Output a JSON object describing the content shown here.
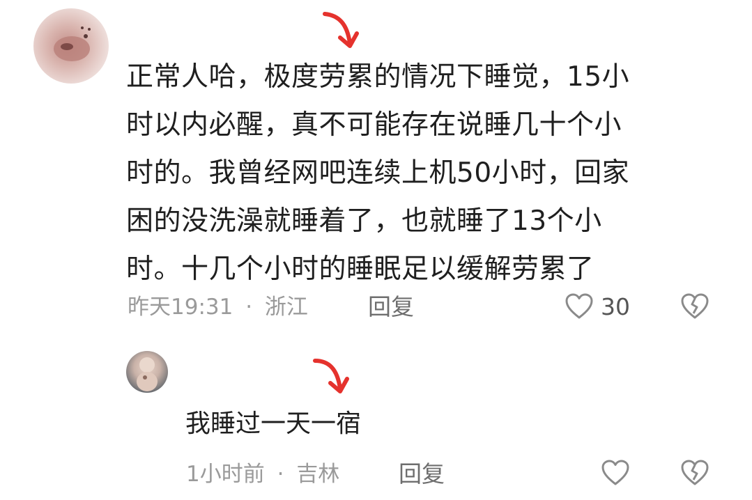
{
  "comment": {
    "text": "正常人哈，极度劳累的情况下睡觉，15小\n时以内必醒，真不可能存在说睡几十个小\n时的。我曾经网吧连续上机50小时，回家\n困的没洗澡就睡着了，也就睡了13个小\n时。十几个小时的睡眠足以缓解劳累了",
    "time": "昨天19:31",
    "location": "浙江",
    "separator": "·",
    "reply_label": "回复",
    "like_count": "30"
  },
  "reply": {
    "text": "我睡过一天一宿",
    "time": "1小时前",
    "location": "吉林",
    "separator": "·",
    "reply_label": "回复"
  },
  "colors": {
    "annotation_arrow": "#e5322d",
    "meta_text": "#9a9a9a",
    "body_text": "#1f1f1f",
    "icon_gray": "#8a8a8a"
  },
  "icons": [
    "heart-outline-icon",
    "broken-heart-icon",
    "red-arrow-annotation"
  ]
}
